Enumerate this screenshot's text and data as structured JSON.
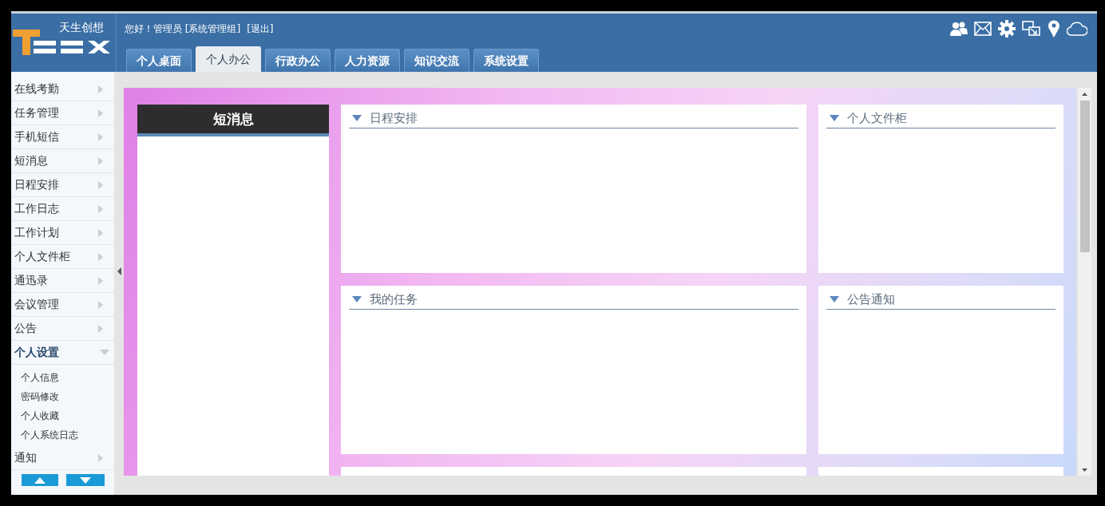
{
  "header": {
    "logo_text": "天生创想",
    "greeting": "您好！管理员 [系统管理组]",
    "logout": "[退出]"
  },
  "tabs": [
    {
      "label": "个人桌面",
      "selected": false
    },
    {
      "label": "个人办公",
      "selected": true
    },
    {
      "label": "行政办公",
      "selected": false
    },
    {
      "label": "人力资源",
      "selected": false
    },
    {
      "label": "知识交流",
      "selected": false
    },
    {
      "label": "系统设置",
      "selected": false
    }
  ],
  "sidebar": {
    "items": [
      {
        "label": "在线考勤",
        "expanded": false
      },
      {
        "label": "任务管理",
        "expanded": false
      },
      {
        "label": "手机短信",
        "expanded": false
      },
      {
        "label": "短消息",
        "expanded": false
      },
      {
        "label": "日程安排",
        "expanded": false
      },
      {
        "label": "工作日志",
        "expanded": false
      },
      {
        "label": "工作计划",
        "expanded": false
      },
      {
        "label": "个人文件柜",
        "expanded": false
      },
      {
        "label": "通迅录",
        "expanded": false
      },
      {
        "label": "会议管理",
        "expanded": false
      },
      {
        "label": "公告",
        "expanded": false
      },
      {
        "label": "个人设置",
        "expanded": true,
        "children": [
          {
            "label": "个人信息"
          },
          {
            "label": "密码修改"
          },
          {
            "label": "个人收藏"
          },
          {
            "label": "个人系统日志"
          }
        ]
      },
      {
        "label": "通知",
        "expanded": false
      }
    ]
  },
  "sms_panel": {
    "title": "短消息"
  },
  "portlets": [
    {
      "kind": "titled",
      "title": "日程安排"
    },
    {
      "kind": "titled",
      "title": "个人文件柜"
    },
    {
      "kind": "titled",
      "title": "我的任务"
    },
    {
      "kind": "titled",
      "title": "公告通知"
    },
    {
      "kind": "cut"
    },
    {
      "kind": "cut"
    }
  ]
}
